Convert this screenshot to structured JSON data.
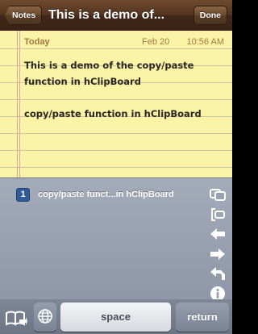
{
  "navbar": {
    "back_label": "Notes",
    "title": "This is a demo of...",
    "done_label": "Done"
  },
  "note": {
    "day": "Today",
    "date": "Feb 20",
    "time": "10:56 AM",
    "lines": [
      "This is a demo of the copy/paste",
      "function in hClipBoard",
      "",
      "copy/paste function in hClipBoard"
    ]
  },
  "clipboard": {
    "items": [
      {
        "index": "1",
        "text": "copy/paste funct...in hClipBoard"
      }
    ],
    "side_icons": [
      "copy-icon",
      "cut-icon",
      "arrow-left-icon",
      "arrow-right-icon",
      "undo-icon",
      "info-icon"
    ]
  },
  "keyboard": {
    "space_label": "space",
    "return_label": "return",
    "book_icon": "book-icon",
    "globe_icon": "globe-icon"
  },
  "colors": {
    "nav_brown": "#4e3420",
    "paper_yellow": "#fbf3a5",
    "meta_brown": "#a3773f",
    "panel_gray": "#9aa1b0",
    "badge_blue": "#2f5c98"
  }
}
